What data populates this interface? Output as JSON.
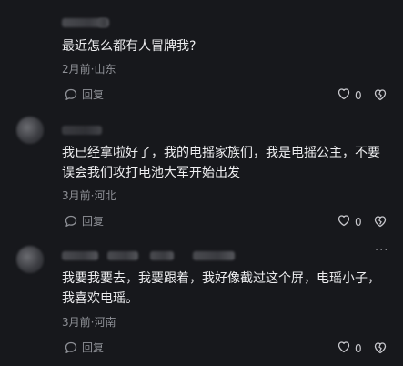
{
  "comments": [
    {
      "text": "最近怎么都有人冒牌我?",
      "meta": "2月前·山东",
      "reply_label": "回复",
      "like_count": "0"
    },
    {
      "text": "我已经拿啦好了，我的电摇家族们，我是电摇公主，不要误会我们攻打电池大军开始出发",
      "meta": "3月前·河北",
      "reply_label": "回复",
      "like_count": "0"
    },
    {
      "text": "我要我要去，我要跟着，我好像截过这个屏，电瑶小子，我喜欢电瑶。",
      "meta": "3月前·河南",
      "reply_label": "回复",
      "like_count": "0"
    }
  ],
  "icons": {
    "reply": "reply-icon",
    "like": "heart-icon",
    "dislike": "broken-heart-icon",
    "more": "more-icon"
  },
  "colors": {
    "background": "#17181c",
    "text": "#eeeef0",
    "muted": "#8e9096"
  }
}
